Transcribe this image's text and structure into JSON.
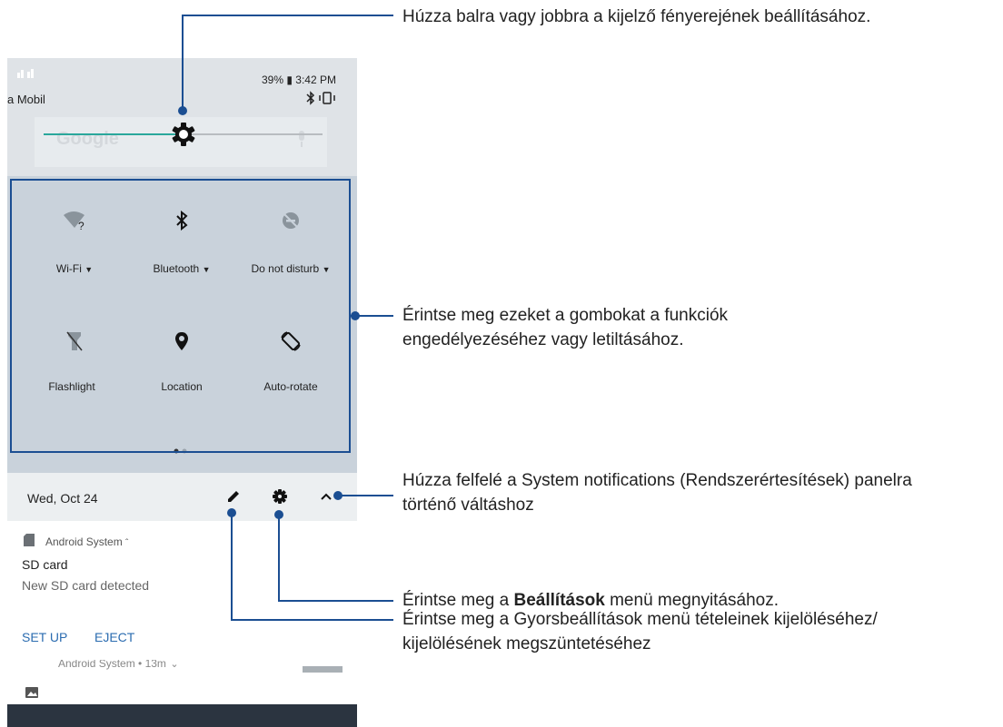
{
  "status_bar": {
    "battery_time": "39% ▮ 3:42 PM",
    "carrier": "a Mobil"
  },
  "search": {
    "text": "Google"
  },
  "brightness": {
    "level": 0.5
  },
  "quick_settings": {
    "tiles": [
      {
        "label": "Wi-Fi",
        "icon": "wifi-question-icon",
        "has_dropdown": true
      },
      {
        "label": "Bluetooth",
        "icon": "bluetooth-icon",
        "has_dropdown": true
      },
      {
        "label": "Do not disturb",
        "icon": "do-not-disturb-icon",
        "has_dropdown": true
      },
      {
        "label": "Flashlight",
        "icon": "flashlight-icon",
        "has_dropdown": false
      },
      {
        "label": "Location",
        "icon": "location-pin-icon",
        "has_dropdown": false
      },
      {
        "label": "Auto-rotate",
        "icon": "auto-rotate-icon",
        "has_dropdown": false
      }
    ],
    "page_count": 2,
    "current_page": 1
  },
  "footer": {
    "date": "Wed, Oct 24"
  },
  "notification": {
    "app": "Android System",
    "title": "SD card",
    "text": "New SD card detected",
    "actions": [
      "SET UP",
      "EJECT"
    ],
    "next_app_line": "Android System • 13m"
  },
  "callouts": {
    "brightness": "Húzza balra vagy jobbra a kijelző fényerejének beállításához.",
    "buttons_line1": "Érintse meg ezeket a gombokat a funkciók",
    "buttons_line2": "engedélyezéséhez vagy letiltásához.",
    "system_line1": "Húzza felfelé a System notifications (Rendszerértesítések) panelra",
    "system_line2": "történő váltáshoz",
    "settings_prefix": "Érintse meg a ",
    "settings_bold": "Beállítások",
    "settings_suffix": " menü megnyitásához.",
    "edit_line1": "Érintse meg a Gyorsbeállítások menü tételeinek kijelöléséhez/",
    "edit_line2": "kijelölésének megszüntetéséhez"
  },
  "colors": {
    "callout_line": "#1b4e92",
    "accent": "#2aa79b",
    "panel": "#c9d2db"
  }
}
